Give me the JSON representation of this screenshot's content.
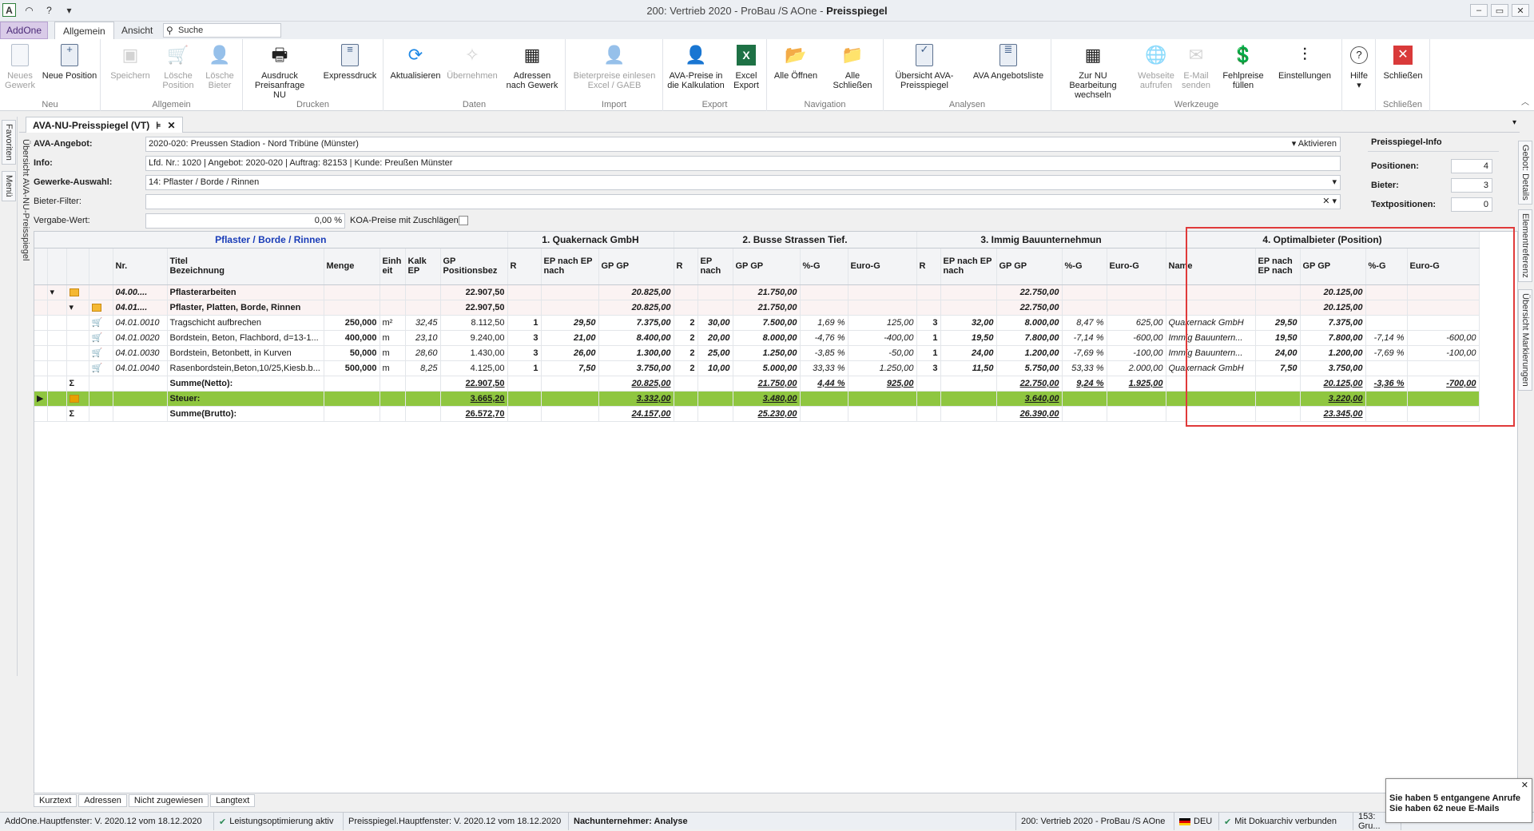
{
  "window": {
    "title_prefix": "200: Vertrieb 2020 - ProBau /S AOne - ",
    "title_bold": "Preisspiegel"
  },
  "ribbon_tabs": {
    "addone": "AddOne",
    "allgemein": "Allgemein",
    "ansicht": "Ansicht"
  },
  "search": {
    "placeholder": "Suche"
  },
  "ribbon": {
    "groups": {
      "neu": "Neu",
      "allgemein": "Allgemein",
      "drucken": "Drucken",
      "daten": "Daten",
      "import": "Import",
      "export": "Export",
      "navigation": "Navigation",
      "analysen": "Analysen",
      "werkzeuge": "Werkzeuge",
      "schliessen": "Schließen"
    },
    "buttons": {
      "neues_gewerk": "Neues Gewerk",
      "neue_position": "Neue Position",
      "speichern": "Speichern",
      "loesche_position": "Lösche Position",
      "loesche_bieter": "Lösche Bieter",
      "ausdruck": "Ausdruck Preisanfrage NU",
      "expressdruck": "Expressdruck",
      "aktualisieren": "Aktualisieren",
      "uebernehmen": "Übernehmen",
      "adressen": "Adressen nach Gewerk",
      "bieterpreise": "Bieterpreise einlesen Excel / GAEB",
      "ava_preise": "AVA-Preise in die Kalkulation",
      "excel_export": "Excel Export",
      "alle_oeffnen": "Alle Öffnen",
      "alle_schliessen": "Alle Schließen",
      "uebersicht": "Übersicht AVA-Preisspiegel",
      "angebotsliste": "AVA Angebotsliste",
      "zur_nu": "Zur NU Bearbeitung wechseln",
      "webseite": "Webseite aufrufen",
      "email": "E-Mail senden",
      "fehlpreise": "Fehlpreise füllen",
      "einstellungen": "Einstellungen",
      "hilfe": "Hilfe",
      "schliessen": "Schließen"
    }
  },
  "doc_tab": {
    "label": "AVA-NU-Preisspiegel (VT)",
    "pin": "⊧",
    "close": "✕"
  },
  "left_rail": {
    "favoriten": "Favoriten",
    "menue": "Menü",
    "uebersicht": "Übersicht AVA-NU-Preisspiegel"
  },
  "right_rail": {
    "details": "Gebot: Details",
    "element": "Elementreferenz",
    "markierungen": "Übersicht Markierungen"
  },
  "filters": {
    "ava_angebot_label": "AVA-Angebot:",
    "ava_angebot_value": "2020-020: Preussen Stadion - Nord Tribüne (Münster)",
    "aktivieren": "Aktivieren",
    "info_label": "Info:",
    "info_value": "Lfd. Nr.: 1020 | Angebot: 2020-020 | Auftrag: 82153 | Kunde: Preußen Münster",
    "gewerke_label": "Gewerke-Auswahl:",
    "gewerke_value": "14: Pflaster / Borde / Rinnen",
    "bieter_label": "Bieter-Filter:",
    "bieter_value": "",
    "vergabe_label": "Vergabe-Wert:",
    "vergabe_value": "0,00 %",
    "koa_label": "KOA-Preise mit Zuschlägen:"
  },
  "info_panel": {
    "title": "Preisspiegel-Info",
    "positionen_label": "Positionen:",
    "positionen": "4",
    "bieter_label": "Bieter:",
    "bieter": "3",
    "text_label": "Textpositionen:",
    "text": "0"
  },
  "grid": {
    "group_headers": [
      "Pflaster / Borde / Rinnen",
      "1. Quakernack GmbH",
      "2. Busse Strassen Tief.",
      "3. Immig Bauunternehmun",
      "4. Optimalbieter (Position)"
    ],
    "col_headers": {
      "nr": "Nr.",
      "titel": "Titel",
      "bezeichnung": "Bezeichnung",
      "menge": "Menge",
      "einheit": "Einh eit",
      "kalk": "Kalk EP",
      "gp": "GP Positionsbez",
      "r": "R",
      "ep_nach": "EP nach EP nach",
      "gp_gp": "GP GP",
      "ep_nach2": "EP nach",
      "pg": "%-G",
      "eg": "Euro-G",
      "name": "Name"
    },
    "rows": [
      {
        "type": "grp",
        "nr": "04.00....",
        "bez": "Pflasterarbeiten",
        "gp": "22.907,50",
        "b1gp": "20.825,00",
        "b2gp": "21.750,00",
        "b3gp": "22.750,00",
        "ogp": "20.125,00"
      },
      {
        "type": "grp",
        "nr": "04.01....",
        "bez": "Pflaster, Platten, Borde, Rinnen",
        "gp": "22.907,50",
        "b1gp": "20.825,00",
        "b2gp": "21.750,00",
        "b3gp": "22.750,00",
        "ogp": "20.125,00"
      },
      {
        "type": "pos",
        "nr": "04.01.0010",
        "bez": "Tragschicht aufbrechen",
        "menge": "250,000",
        "einh": "m²",
        "kalk": "32,45",
        "gp": "8.112,50",
        "b1r": "1",
        "b1ep": "29,50",
        "b1gp": "7.375,00",
        "b2r": "2",
        "b2ep": "30,00",
        "b2gp": "7.500,00",
        "b2pg": "1,69 %",
        "b2eg": "125,00",
        "b3r": "3",
        "b3ep": "32,00",
        "b3gp": "8.000,00",
        "b3pg": "8,47 %",
        "b3eg": "625,00",
        "oname": "Quakernack GmbH",
        "oep": "29,50",
        "ogp": "7.375,00",
        "opg": "",
        "oeg": ""
      },
      {
        "type": "pos",
        "nr": "04.01.0020",
        "bez": "Bordstein, Beton, Flachbord, d=13-1...",
        "menge": "400,000",
        "einh": "m",
        "kalk": "23,10",
        "gp": "9.240,00",
        "b1r": "3",
        "b1ep": "21,00",
        "b1gp": "8.400,00",
        "b2r": "2",
        "b2ep": "20,00",
        "b2gp": "8.000,00",
        "b2pg": "-4,76 %",
        "b2eg": "-400,00",
        "b3r": "1",
        "b3ep": "19,50",
        "b3gp": "7.800,00",
        "b3pg": "-7,14 %",
        "b3eg": "-600,00",
        "oname": "Immig Bauuntern...",
        "oep": "19,50",
        "ogp": "7.800,00",
        "opg": "-7,14 %",
        "oeg": "-600,00"
      },
      {
        "type": "pos",
        "nr": "04.01.0030",
        "bez": "Bordstein, Betonbett, in Kurven",
        "menge": "50,000",
        "einh": "m",
        "kalk": "28,60",
        "gp": "1.430,00",
        "b1r": "3",
        "b1ep": "26,00",
        "b1gp": "1.300,00",
        "b2r": "2",
        "b2ep": "25,00",
        "b2gp": "1.250,00",
        "b2pg": "-3,85 %",
        "b2eg": "-50,00",
        "b3r": "1",
        "b3ep": "24,00",
        "b3gp": "1.200,00",
        "b3pg": "-7,69 %",
        "b3eg": "-100,00",
        "oname": "Immig Bauuntern...",
        "oep": "24,00",
        "ogp": "1.200,00",
        "opg": "-7,69 %",
        "oeg": "-100,00"
      },
      {
        "type": "pos",
        "nr": "04.01.0040",
        "bez": "Rasenbordstein,Beton,10/25,Kiesb.b...",
        "menge": "500,000",
        "einh": "m",
        "kalk": "8,25",
        "gp": "4.125,00",
        "b1r": "1",
        "b1ep": "7,50",
        "b1gp": "3.750,00",
        "b2r": "2",
        "b2ep": "10,00",
        "b2gp": "5.000,00",
        "b2pg": "33,33 %",
        "b2eg": "1.250,00",
        "b3r": "3",
        "b3ep": "11,50",
        "b3gp": "5.750,00",
        "b3pg": "53,33 %",
        "b3eg": "2.000,00",
        "oname": "Quakernack GmbH",
        "oep": "7,50",
        "ogp": "3.750,00",
        "opg": "",
        "oeg": ""
      },
      {
        "type": "sum",
        "bez": "Summe(Netto):",
        "gp": "22.907,50",
        "b1gp": "20.825,00",
        "b2gp": "21.750,00",
        "b2pg": "4,44 %",
        "b2eg": "925,00",
        "b3gp": "22.750,00",
        "b3pg": "9,24 %",
        "b3eg": "1.925,00",
        "ogp": "20.125,00",
        "opg": "-3,36 %",
        "oeg": "-700,00"
      },
      {
        "type": "steuer",
        "bez": "Steuer:",
        "gp": "3.665,20",
        "b1gp": "3.332,00",
        "b2gp": "3.480,00",
        "b3gp": "3.640,00",
        "ogp": "3.220,00"
      },
      {
        "type": "sum",
        "bez": "Summe(Brutto):",
        "gp": "26.572,70",
        "b1gp": "24.157,00",
        "b2gp": "25.230,00",
        "b3gp": "26.390,00",
        "ogp": "23.345,00"
      }
    ]
  },
  "bottom_tabs": [
    "Kurztext",
    "Adressen",
    "Nicht zugewiesen",
    "Langtext"
  ],
  "status": {
    "s1": "AddOne.Hauptfenster: V. 2020.12 vom 18.12.2020",
    "s2": "Leistungsoptimierung aktiv",
    "s3": "Preisspiegel.Hauptfenster: V. 2020.12 vom 18.12.2020",
    "s4": "Nachunternehmer: Analyse",
    "s5": "200: Vertrieb 2020 - ProBau /S AOne",
    "s6": "DEU",
    "s7": "Mit Dokuarchiv verbunden",
    "s8": "153: Gru..."
  },
  "notification": {
    "line1": "Sie haben 5 entgangene Anrufe",
    "line2": "Sie haben 62 neue E-Mails"
  }
}
